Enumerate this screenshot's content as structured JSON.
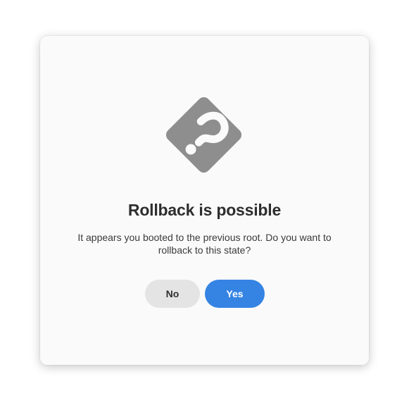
{
  "dialog": {
    "icon": "question-diamond-icon",
    "title": "Rollback is possible",
    "message": "It appears you booted to the previous root. Do you want to rollback to this state?",
    "buttons": {
      "no_label": "No",
      "yes_label": "Yes"
    }
  },
  "colors": {
    "dialog_bg": "#fafafa",
    "icon_gray": "#8e8e8e",
    "title_text": "#2e2e2e",
    "no_button_bg": "#e4e4e4",
    "yes_button_bg": "#3584e4",
    "yes_button_text": "#ffffff"
  }
}
